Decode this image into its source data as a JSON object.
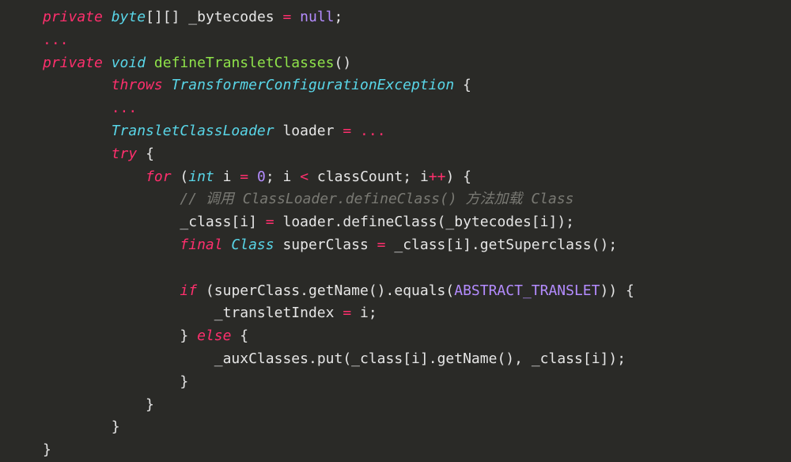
{
  "tok": {
    "kw_private": "private",
    "kw_throws": "throws",
    "kw_try": "try",
    "kw_for": "for",
    "kw_final": "final",
    "kw_if": "if",
    "kw_else": "else",
    "ty_byte": "byte",
    "ty_void": "void",
    "ty_int": "int",
    "ty_Class": "Class",
    "ty_TransformerConfigurationException": "TransformerConfigurationException",
    "ty_TransletClassLoader": "TransletClassLoader",
    "fn_defineTransletClasses": "defineTransletClasses",
    "id_bytecodes": "_bytecodes",
    "id_loader": "loader",
    "id_i": "i",
    "id_classCount": "classCount",
    "id_class": "_class",
    "id_defineClass": "defineClass",
    "id_superClass": "superClass",
    "id_getSuperclass": "getSuperclass",
    "id_getName": "getName",
    "id_equals": "equals",
    "id_transletIndex": "_transletIndex",
    "id_auxClasses": "_auxClasses",
    "id_put": "put",
    "const_ABSTRACT_TRANSLET": "ABSTRACT_TRANSLET",
    "const_null": "null",
    "num_0": "0",
    "ellipsis": "...",
    "comment_defineClass": "// 调用 ClassLoader.defineClass() 方法加载 Class"
  }
}
